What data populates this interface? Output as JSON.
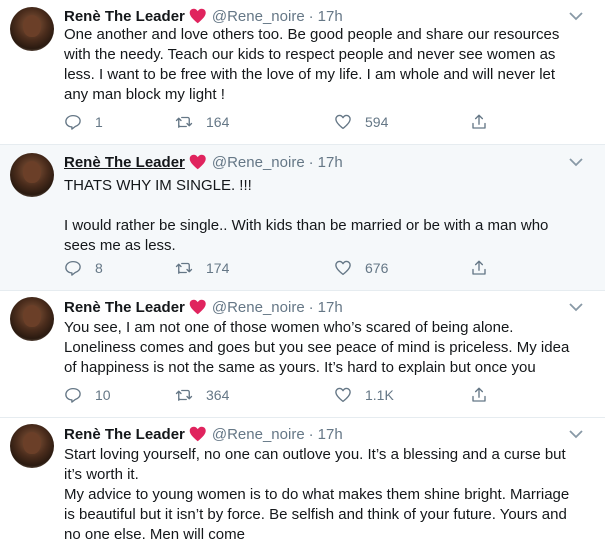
{
  "colors": {
    "accent": "#1da1f2",
    "heart": "#e0245e",
    "muted": "#657786",
    "highlight_bg": "#f5f8fa"
  },
  "icons": {
    "reply": "reply-icon",
    "retweet": "retweet-icon",
    "like": "like-icon",
    "share": "share-icon",
    "heart": "red-heart-emoji",
    "caret": "chevron-down-icon"
  },
  "tweets": [
    {
      "name": "Renè The Leader",
      "handle": "@Rene_noire",
      "dot": "·",
      "time": "17h",
      "text": [
        "One another and love others too. Be good people and share our resources",
        "with the needy. Teach our kids to respect people and never see women as",
        "less. I want to be free with the love of my life. I am whole and will never let",
        "any man block my light !"
      ],
      "replies": "1",
      "retweets": "164",
      "likes": "594"
    },
    {
      "name": "Renè The Leader",
      "handle": "@Rene_noire",
      "dot": "·",
      "time": "17h",
      "text": [
        "THATS WHY IM SINGLE. !!!",
        "",
        "I would rather be single.. With kids than be married or be with a man who",
        "sees me as less."
      ],
      "replies": "8",
      "retweets": "174",
      "likes": "676"
    },
    {
      "name": "Renè The Leader",
      "handle": "@Rene_noire",
      "dot": "·",
      "time": "17h",
      "text": [
        "You see, I am not one of those women who’s scared of being alone.",
        "Loneliness comes and goes but you see peace of mind is priceless. My idea",
        "of happiness is not the same as yours. It’s hard to explain but once you"
      ],
      "replies": "10",
      "retweets": "364",
      "likes": "1.1K"
    },
    {
      "name": "Renè The Leader",
      "handle": "@Rene_noire",
      "dot": "·",
      "time": "17h",
      "text": [
        "Start loving yourself, no one can outlove you. It’s a blessing and a curse but",
        "it’s worth it.",
        "My advice to young women is to do what makes them shine bright. Marriage",
        "is beautiful but it isn’t by force. Be selfish and think of your future. Yours and",
        "no one else. Men will come"
      ]
    }
  ]
}
